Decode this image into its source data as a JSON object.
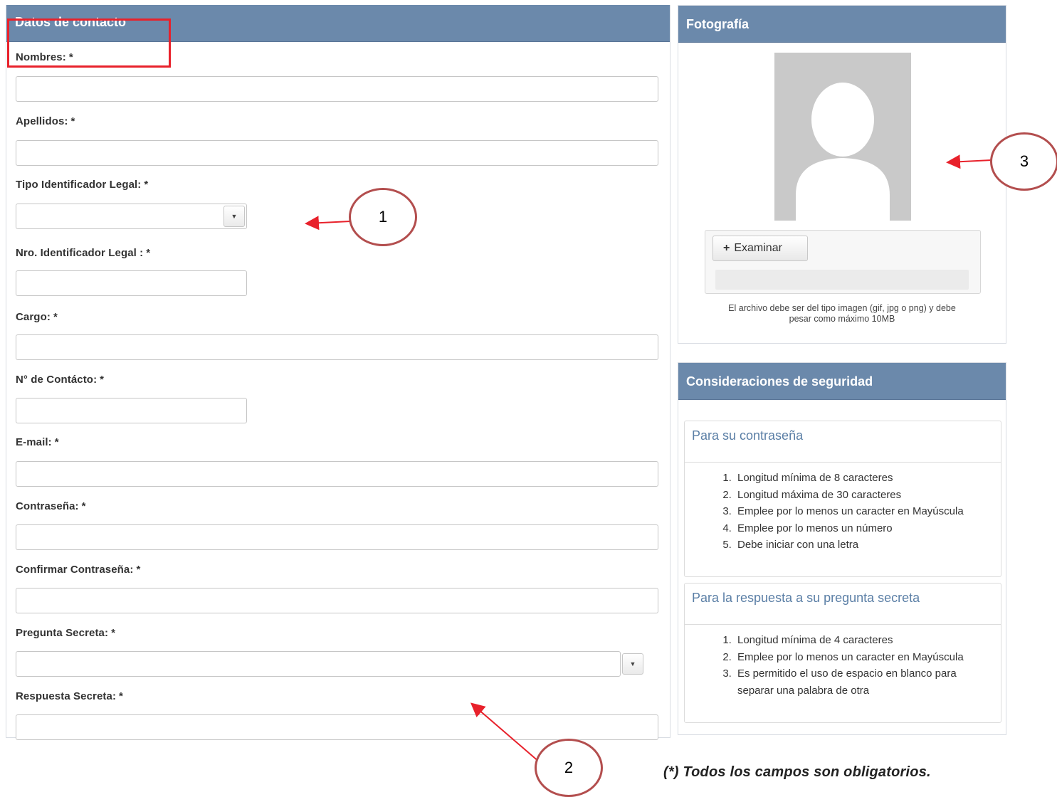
{
  "contact_panel": {
    "title": "Datos de contacto",
    "fields": {
      "nombres": "Nombres:",
      "apellidos": "Apellidos:",
      "tipo_id": "Tipo Identificador Legal:",
      "nro_id": "Nro. Identificador Legal :",
      "cargo": "Cargo:",
      "contacto": "N° de Contácto:",
      "email": "E-mail:",
      "password": "Contraseña:",
      "confirm_password": "Confirmar Contraseña:",
      "pregunta": "Pregunta Secreta:",
      "respuesta": "Respuesta Secreta:"
    },
    "required_mark": "*",
    "dropdown_arrow": "▼"
  },
  "photo_panel": {
    "title": "Fotografía",
    "browse_icon": "+",
    "browse_label": "Examinar",
    "note_line1": "El archivo debe ser del tipo imagen (gif, jpg o png) y debe",
    "note_line2": "pesar como máximo 10MB"
  },
  "security_panel": {
    "title": "Consideraciones de seguridad",
    "password_section": {
      "title": "Para su contraseña",
      "items": [
        "Longitud mínima de 8 caracteres",
        "Longitud máxima de 30 caracteres",
        "Emplee por lo menos un caracter en Mayúscula",
        "Emplee por lo menos un número",
        "Debe iniciar con una letra"
      ]
    },
    "answer_section": {
      "title": "Para la respuesta a su pregunta secreta",
      "items": [
        "Longitud mínima de 4 caracteres",
        "Emplee por lo menos un caracter en Mayúscula",
        "Es permitido el uso de espacio en blanco para separar una palabra de otra"
      ]
    }
  },
  "annotations": {
    "callout_1": "1",
    "callout_2": "2",
    "callout_3": "3",
    "arrow_color": "#e8212b",
    "circle_color": "#b34e4e"
  },
  "footer_note": "(*) Todos los campos son obligatorios."
}
